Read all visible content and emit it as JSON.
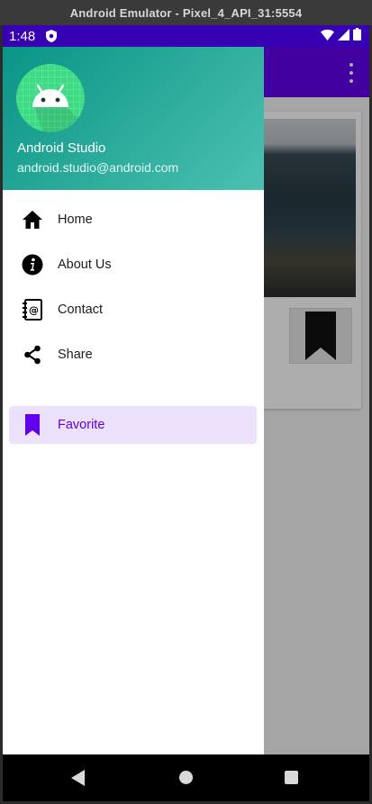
{
  "window": {
    "title": "Android Emulator - Pixel_4_API_31:5554"
  },
  "status_bar": {
    "time": "1:48"
  },
  "drawer": {
    "user_name": "Android Studio",
    "user_email": "android.studio@android.com",
    "items": [
      {
        "label": "Home",
        "icon": "home-icon"
      },
      {
        "label": "About Us",
        "icon": "info-icon"
      },
      {
        "label": "Contact",
        "icon": "contact-book-icon"
      },
      {
        "label": "Share",
        "icon": "share-icon"
      },
      {
        "label": "Favorite",
        "icon": "bookmark-icon",
        "selected": true
      }
    ]
  },
  "colors": {
    "primary": "#6200ee",
    "status_bar": "#3700b3",
    "header_teal": "#26a69a",
    "selected_bg": "#ece1fb"
  }
}
